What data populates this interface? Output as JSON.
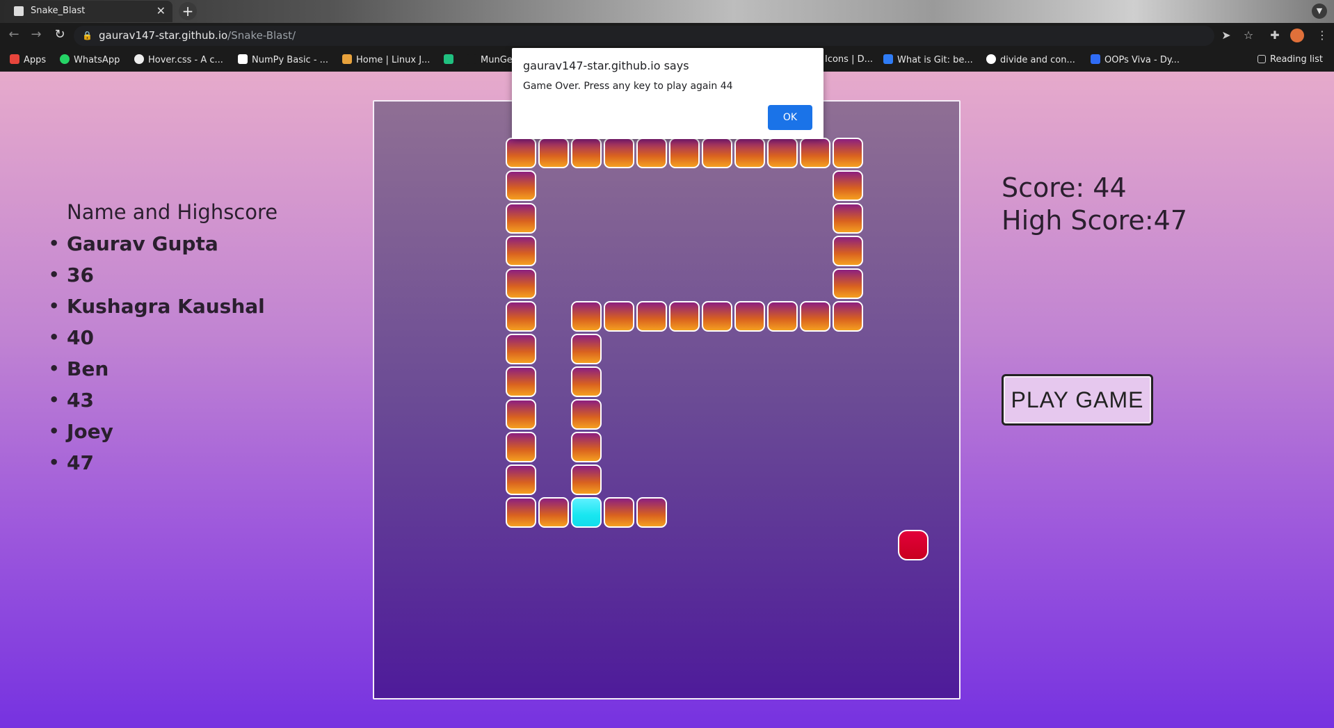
{
  "browser": {
    "tab_title": "Snake_Blast",
    "url_host": "gaurav147-star.github.io",
    "url_path": "/Snake-Blast/",
    "bookmarks": [
      "Apps",
      "WhatsApp",
      "Hover.css - A c...",
      "NumPy Basic - ...",
      "Home | Linux J...",
      "MunGe",
      "Icons | D...",
      "What is Git: be...",
      "divide and con...",
      "OOPs Viva - Dy..."
    ],
    "reading_list": "Reading list"
  },
  "dialog": {
    "origin": "gaurav147-star.github.io says",
    "message": "Game Over. Press any key to play again 44",
    "ok_label": "OK"
  },
  "leaderboard": {
    "heading": "Name and Highscore",
    "entries": [
      "Gaurav Gupta",
      "36",
      "Kushagra Kaushal",
      "40",
      "Ben",
      "43",
      "Joey",
      "47"
    ]
  },
  "score": {
    "current": "Score: 44",
    "high": "High Score:47"
  },
  "play_button": "PLAY GAME",
  "game": {
    "grid_size": 18,
    "snake_segments": [
      [
        2,
        1
      ],
      [
        3,
        1
      ],
      [
        4,
        1
      ],
      [
        5,
        1
      ],
      [
        6,
        1
      ],
      [
        7,
        1
      ],
      [
        8,
        1
      ],
      [
        9,
        1
      ],
      [
        10,
        1
      ],
      [
        11,
        1
      ],
      [
        12,
        1
      ],
      [
        2,
        2
      ],
      [
        12,
        2
      ],
      [
        2,
        3
      ],
      [
        12,
        3
      ],
      [
        2,
        4
      ],
      [
        12,
        4
      ],
      [
        2,
        5
      ],
      [
        12,
        5
      ],
      [
        2,
        6
      ],
      [
        4,
        6
      ],
      [
        5,
        6
      ],
      [
        6,
        6
      ],
      [
        7,
        6
      ],
      [
        8,
        6
      ],
      [
        9,
        6
      ],
      [
        10,
        6
      ],
      [
        11,
        6
      ],
      [
        12,
        6
      ],
      [
        2,
        7
      ],
      [
        4,
        7
      ],
      [
        2,
        8
      ],
      [
        4,
        8
      ],
      [
        2,
        9
      ],
      [
        4,
        9
      ],
      [
        2,
        10
      ],
      [
        4,
        10
      ],
      [
        2,
        11
      ],
      [
        4,
        11
      ],
      [
        2,
        12
      ],
      [
        3,
        12
      ],
      [
        5,
        12
      ],
      [
        6,
        12
      ]
    ],
    "snake_head": [
      4,
      12
    ],
    "food": [
      14,
      13
    ]
  }
}
